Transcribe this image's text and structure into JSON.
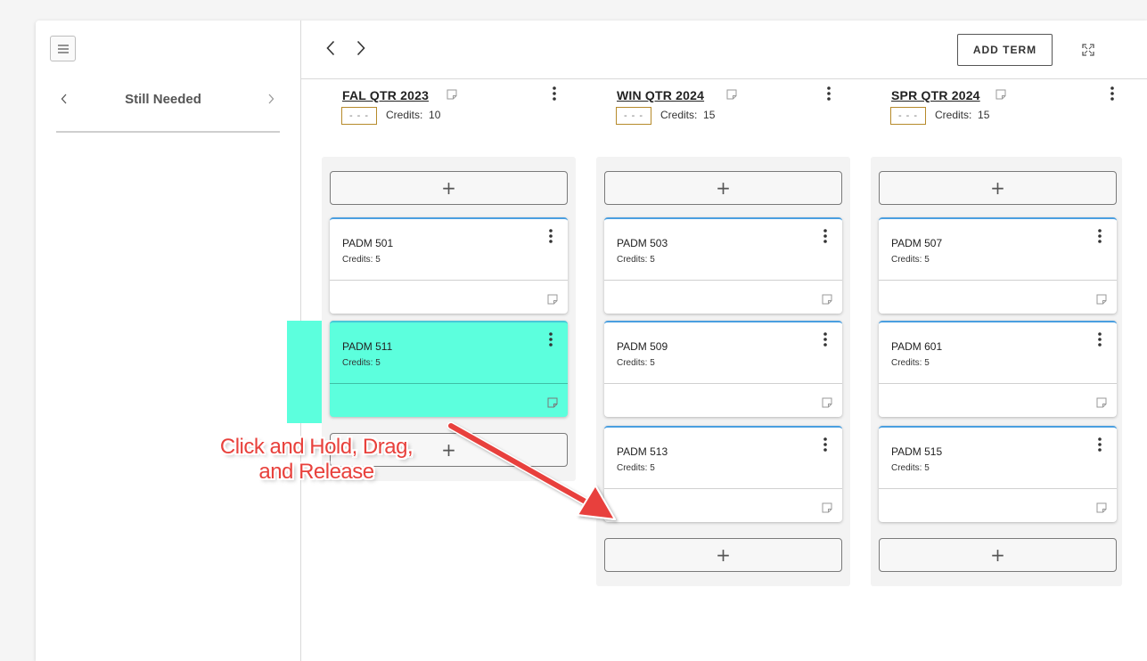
{
  "left_panel": {
    "section_title": "Still Needed"
  },
  "toolbar": {
    "add_term_label": "ADD TERM"
  },
  "terms": [
    {
      "name": "FAL QTR 2023",
      "dash_label": "- - -",
      "credits_label": "Credits:",
      "credits_value": "10",
      "add_symbol": "+",
      "courses": [
        {
          "code": "PADM 501",
          "credits": "Credits: 5"
        },
        {
          "code": "PADM 511",
          "credits": "Credits: 5"
        }
      ]
    },
    {
      "name": "WIN QTR 2024",
      "dash_label": "- - -",
      "credits_label": "Credits:",
      "credits_value": "15",
      "add_symbol": "+",
      "courses": [
        {
          "code": "PADM 503",
          "credits": "Credits: 5"
        },
        {
          "code": "PADM 509",
          "credits": "Credits: 5"
        },
        {
          "code": "PADM 513",
          "credits": "Credits: 5"
        }
      ]
    },
    {
      "name": "SPR QTR 2024",
      "dash_label": "- - -",
      "credits_label": "Credits:",
      "credits_value": "15",
      "add_symbol": "+",
      "courses": [
        {
          "code": "PADM 507",
          "credits": "Credits: 5"
        },
        {
          "code": "PADM 601",
          "credits": "Credits: 5"
        },
        {
          "code": "PADM 515",
          "credits": "Credits: 5"
        }
      ]
    }
  ],
  "annotation": {
    "line1": "Click and Hold, Drag,",
    "line2": "and Release"
  },
  "colors": {
    "card_top_border": "#4a9fe0",
    "dragging_card": "#5cffdd",
    "annotation_text": "#e8413c",
    "arrow": "#e8413c",
    "dashbox_border": "#b68a2a"
  },
  "icons": {
    "menu": "hamburger-icon",
    "prev": "chevron-left-icon",
    "next": "chevron-right-icon",
    "expand": "expand-icon",
    "note": "note-icon",
    "more": "kebab-icon"
  }
}
